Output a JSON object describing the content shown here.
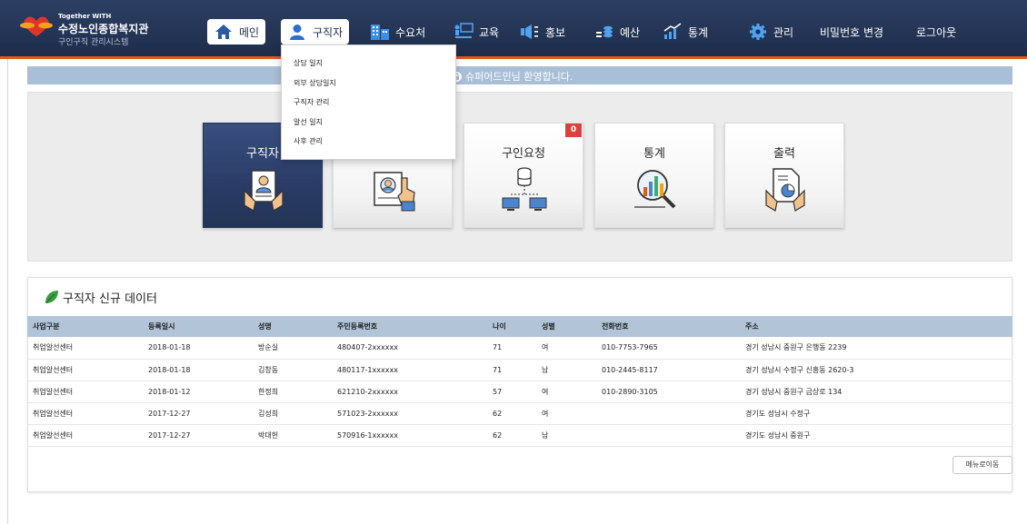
{
  "brand": {
    "small": "Together WITH",
    "main": "수정노인종합복지관",
    "sub": "구인구직 관리시스템"
  },
  "nav": {
    "main": "메인",
    "jobseeker": "구직자",
    "demand": "수요처",
    "education": "교육",
    "promotion": "홍보",
    "budget": "예산",
    "stats": "통계",
    "admin": "관리",
    "change_password": "비밀번호 변경",
    "logout": "로그아웃"
  },
  "dropdown": {
    "items": [
      "상담 일지",
      "외부 상담일지",
      "구직자 관리",
      "알선 일지",
      "사후 관리"
    ]
  },
  "welcome": "슈퍼어드민님 환영합니다.",
  "tiles": [
    {
      "label": "구직자"
    },
    {
      "label": ""
    },
    {
      "label": "구인요청",
      "badge": "0"
    },
    {
      "label": "통계"
    },
    {
      "label": "출력"
    }
  ],
  "data_panel": {
    "title": "구직자 신규 데이터",
    "columns": [
      "사업구분",
      "등록일시",
      "성명",
      "주민등록번호",
      "나이",
      "성별",
      "전화번호",
      "주소"
    ],
    "rows": [
      [
        "취업알선센터",
        "2018-01-18",
        "방순실",
        "480407-2xxxxxx",
        "71",
        "여",
        "010-7753-7965",
        "경기 성남시 중원구 은행동 2239"
      ],
      [
        "취업알선센터",
        "2018-01-18",
        "김창동",
        "480117-1xxxxxx",
        "71",
        "남",
        "010-2445-8117",
        "경기 성남시 수정구 신흥동 2620-3"
      ],
      [
        "취업알선센터",
        "2018-01-12",
        "한정희",
        "621210-2xxxxxx",
        "57",
        "여",
        "010-2890-3105",
        "경기 성남시 중원구 금상로 134"
      ],
      [
        "취업알선센터",
        "2017-12-27",
        "김성희",
        "571023-2xxxxxx",
        "62",
        "여",
        "",
        "경기도 성남시 수정구"
      ],
      [
        "취업알선센터",
        "2017-12-27",
        "박대헌",
        "570916-1xxxxxx",
        "62",
        "남",
        "",
        "경기도 성남시 중원구"
      ]
    ],
    "menu_move": "메뉴로이동"
  },
  "colors": {
    "nav_bg": "#1e2d4b",
    "accent": "#e05a1c",
    "welcome_bar": "#a9bfd7",
    "table_header": "#b2c4d8",
    "active_tile": "#2a3c66",
    "badge": "#d9413c"
  },
  "icons": {
    "main": "home-icon",
    "jobseeker": "person-icon",
    "demand": "building-icon",
    "education": "classroom-icon",
    "promotion": "megaphone-icon",
    "budget": "coins-icon",
    "stats": "chart-icon",
    "admin": "gear-icon"
  }
}
